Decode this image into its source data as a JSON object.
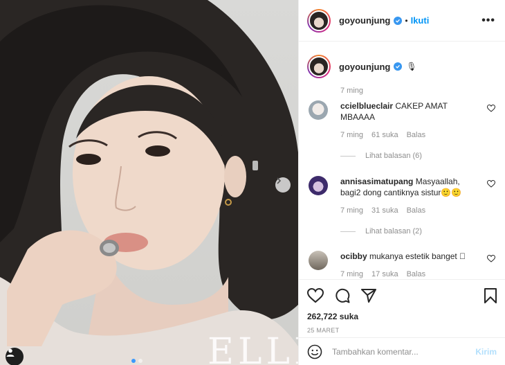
{
  "post": {
    "username": "goyounjung",
    "follow_label": "Ikuti",
    "more_label": "•••",
    "caption_emoji": "🎙",
    "caption_time": "7 ming",
    "likes": "262,722 suka",
    "date": "25 MARET",
    "watermark": "ELLE"
  },
  "comments": [
    {
      "username": "ccielblueclair",
      "text": "CAKEP AMAT MBAAAA",
      "time": "7 ming",
      "likes": "61 suka",
      "reply_label": "Balas",
      "view_replies": "Lihat balasan (6)"
    },
    {
      "username": "annisasimatupang",
      "text": "Masyaallah, bagi2 dong cantiknya sistur🙂🙂",
      "time": "7 ming",
      "likes": "31 suka",
      "reply_label": "Balas",
      "view_replies": "Lihat balasan (2)"
    },
    {
      "username": "ocibby",
      "text": "mukanya estetik banget 🏻",
      "time": "7 ming",
      "likes": "17 suka",
      "reply_label": "Balas"
    }
  ],
  "composer": {
    "placeholder": "Tambahkan komentar...",
    "send_label": "Kirim"
  },
  "colors": {
    "accent": "#0095f6",
    "verified": "#3897f0",
    "muted": "#8e8e8e",
    "send_disabled": "#b2dffc"
  }
}
